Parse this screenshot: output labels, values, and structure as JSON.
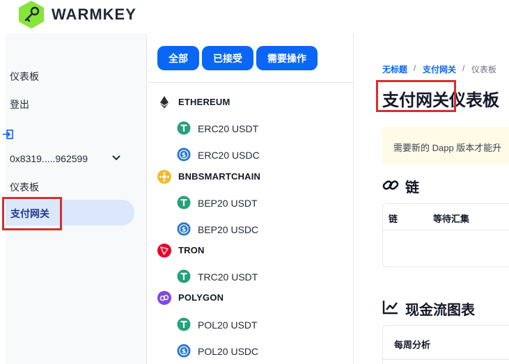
{
  "brand": {
    "name": "WARMKEY",
    "accent": "#86e43a"
  },
  "sidebar": {
    "items": [
      {
        "label": "仪表板"
      },
      {
        "label": "登出"
      },
      {
        "label": "0x8319.....962599"
      },
      {
        "label": "仪表板"
      },
      {
        "label": "支付网关"
      }
    ]
  },
  "filters": [
    {
      "label": "全部"
    },
    {
      "label": "已接受"
    },
    {
      "label": "需要操作"
    }
  ],
  "chains": [
    {
      "name": "ETHEREUM",
      "icon": "ethereum-icon",
      "color": "#2b2b2b",
      "tokens": [
        {
          "label": "ERC20 USDT",
          "icon": "tether-icon"
        },
        {
          "label": "ERC20 USDC",
          "icon": "usdc-icon"
        }
      ]
    },
    {
      "name": "BNBSMARTCHAIN",
      "icon": "bnb-icon",
      "color": "#f3ba2f",
      "tokens": [
        {
          "label": "BEP20 USDT",
          "icon": "tether-icon"
        },
        {
          "label": "BEP20 USDC",
          "icon": "usdc-icon"
        }
      ]
    },
    {
      "name": "TRON",
      "icon": "tron-icon",
      "color": "#eb0029",
      "tokens": [
        {
          "label": "TRC20 USDT",
          "icon": "tether-icon"
        }
      ]
    },
    {
      "name": "POLYGON",
      "icon": "polygon-icon",
      "color": "#8247e5",
      "tokens": [
        {
          "label": "POL20 USDT",
          "icon": "tether-icon"
        },
        {
          "label": "POL20 USDC",
          "icon": "usdc-icon"
        }
      ]
    }
  ],
  "breadcrumb": {
    "root": "无标题",
    "parent": "支付网关",
    "current": "仪表板",
    "sep": "/"
  },
  "page": {
    "title_a": "支付网关",
    "title_b": "仪表板"
  },
  "notice": {
    "text": "需要新的 Dapp 版本才能升"
  },
  "chain_section": {
    "title": "链",
    "col_chain": "链",
    "col_pending": "等待汇集"
  },
  "cashflow_section": {
    "title": "现金流图表",
    "card_title": "每周分析"
  },
  "colors": {
    "primary": "#0a66f5",
    "tether": "#26a17b",
    "usdc": "#2775ca",
    "highlight": "#d32f2f"
  }
}
